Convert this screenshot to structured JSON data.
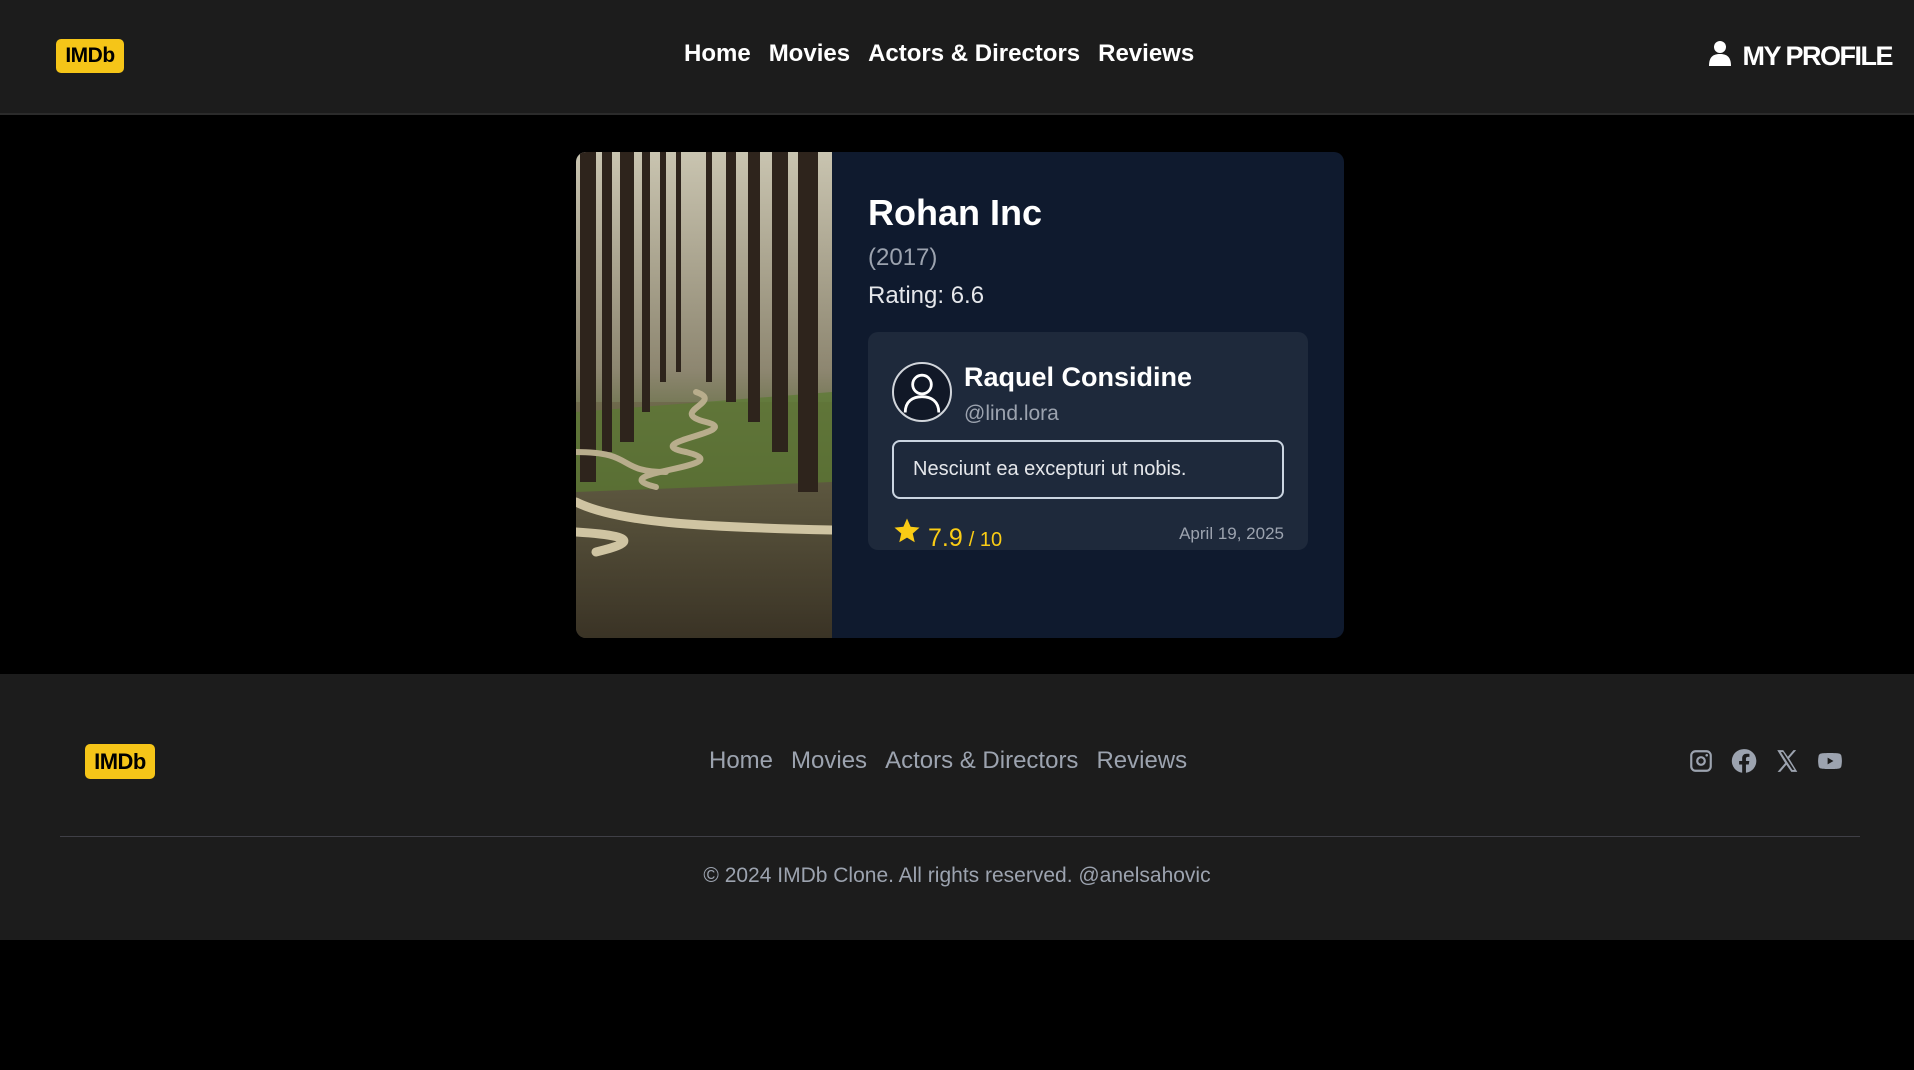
{
  "header": {
    "logo": "IMDb",
    "nav": [
      "Home",
      "Movies",
      "Actors & Directors",
      "Reviews"
    ],
    "profile_label": "MY PROFILE"
  },
  "movie": {
    "title": "Rohan Inc",
    "year": "(2017)",
    "rating": "Rating: 6.6",
    "review": {
      "name": "Raquel Considine",
      "handle": "@lind.lora",
      "comment": "Nesciunt ea excepturi ut nobis.",
      "score": "7.9",
      "score_max": "/ 10",
      "date": "April 19, 2025"
    }
  },
  "footer": {
    "logo": "IMDb",
    "nav": [
      "Home",
      "Movies",
      "Actors & Directors",
      "Reviews"
    ],
    "socials": [
      "instagram-icon",
      "facebook-icon",
      "x-icon",
      "youtube-icon"
    ],
    "copyright": "© 2024 IMDb Clone. All rights reserved. @anelsahovic"
  },
  "colors": {
    "accent": "#f5c518",
    "header_bg": "#1c1c1c",
    "card_bg": "#0f1a2e",
    "review_bg": "#1e293b",
    "star": "#facc15"
  }
}
